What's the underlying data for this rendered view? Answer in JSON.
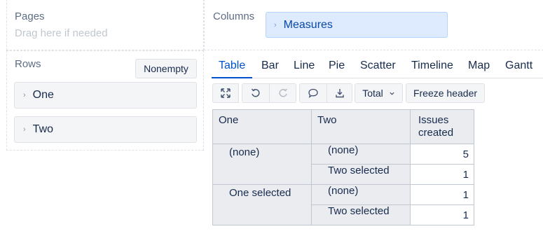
{
  "pages": {
    "label": "Pages",
    "placeholder": "Drag here if needed"
  },
  "columns": {
    "label": "Columns",
    "items": [
      {
        "label": "Measures"
      }
    ]
  },
  "rows": {
    "label": "Rows",
    "nonempty_label": "Nonempty",
    "items": [
      {
        "label": "One"
      },
      {
        "label": "Two"
      }
    ]
  },
  "tabs": [
    {
      "label": "Table",
      "active": true
    },
    {
      "label": "Bar"
    },
    {
      "label": "Line"
    },
    {
      "label": "Pie"
    },
    {
      "label": "Scatter"
    },
    {
      "label": "Timeline"
    },
    {
      "label": "Map"
    },
    {
      "label": "Gantt"
    }
  ],
  "toolbar": {
    "total_label": "Total",
    "freeze_label": "Freeze header",
    "icons": [
      "expand-icon",
      "undo-icon",
      "redo-icon",
      "comment-icon",
      "export-icon",
      "chevron-down-icon"
    ]
  },
  "table": {
    "headers": [
      "One",
      "Two",
      "Issues created"
    ],
    "groups": [
      {
        "one": "(none)",
        "rows": [
          {
            "two": "(none)",
            "value": "5"
          },
          {
            "two": "Two selected",
            "value": "1"
          }
        ]
      },
      {
        "one": "One selected",
        "rows": [
          {
            "two": "(none)",
            "value": "1"
          },
          {
            "two": "Two selected",
            "value": "1"
          }
        ]
      }
    ]
  },
  "colors": {
    "accent": "#0052cc",
    "chip_selected": "#deebff",
    "header_bg": "#ebecf0",
    "border": "#c1c7d0"
  }
}
